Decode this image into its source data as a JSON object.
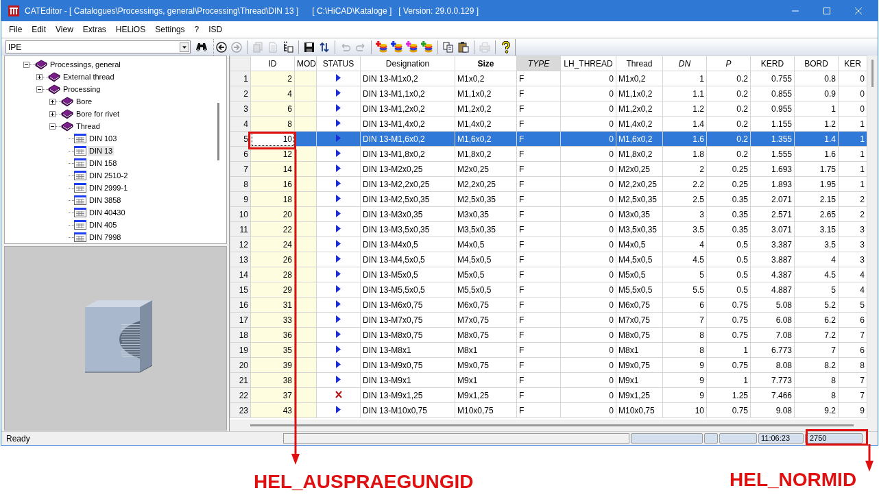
{
  "window": {
    "title": "CATEditor - [ Catalogues\\Processings, general\\Processing\\Thread\\DIN 13 ]      [ C:\\HiCAD\\Kataloge ]   [ Version: 29.0.0.129 ]"
  },
  "menu": [
    "File",
    "Edit",
    "View",
    "Extras",
    "HELiOS",
    "Settings",
    "?",
    "ISD"
  ],
  "combo": {
    "value": "IPE"
  },
  "toolbar": [
    {
      "kind": "back",
      "disabled": false
    },
    {
      "kind": "forward",
      "disabled": true
    },
    {
      "kind": "separator"
    },
    {
      "kind": "copy-doc",
      "disabled": true
    },
    {
      "kind": "doc",
      "disabled": true
    },
    {
      "kind": "doc-list",
      "disabled": false
    },
    {
      "kind": "separator"
    },
    {
      "kind": "save",
      "disabled": false
    },
    {
      "kind": "sort",
      "disabled": false
    },
    {
      "kind": "separator"
    },
    {
      "kind": "undo",
      "disabled": true
    },
    {
      "kind": "redo",
      "disabled": true
    },
    {
      "kind": "separator"
    },
    {
      "kind": "stack-add",
      "disabled": false,
      "color": "#e01010"
    },
    {
      "kind": "stack-add",
      "disabled": false,
      "color": "#1030e0"
    },
    {
      "kind": "stack-add",
      "disabled": false,
      "color": "#e020e0"
    },
    {
      "kind": "stack-add",
      "disabled": false,
      "color": "#20a020"
    },
    {
      "kind": "separator"
    },
    {
      "kind": "copy",
      "disabled": false
    },
    {
      "kind": "paste",
      "disabled": false
    },
    {
      "kind": "separator"
    },
    {
      "kind": "print",
      "disabled": true
    },
    {
      "kind": "separator"
    },
    {
      "kind": "help",
      "disabled": false
    }
  ],
  "tree": {
    "items": [
      {
        "label": "Processings, general",
        "kind": "folder",
        "expanded": true,
        "selected": false,
        "children": [
          {
            "label": "External thread",
            "kind": "folder",
            "expanded": false,
            "selected": false
          },
          {
            "label": "Processing",
            "kind": "folder",
            "expanded": true,
            "selected": false,
            "children": [
              {
                "label": "Bore",
                "kind": "folder",
                "expanded": false,
                "selected": false
              },
              {
                "label": "Bore for rivet",
                "kind": "folder",
                "expanded": false,
                "selected": false
              },
              {
                "label": "Thread",
                "kind": "folder",
                "expanded": true,
                "selected": false,
                "children": [
                  {
                    "label": "DIN 103",
                    "kind": "table",
                    "selected": false
                  },
                  {
                    "label": "DIN 13",
                    "kind": "table",
                    "selected": true
                  },
                  {
                    "label": "DIN 158",
                    "kind": "table",
                    "selected": false
                  },
                  {
                    "label": "DIN 2510-2",
                    "kind": "table",
                    "selected": false
                  },
                  {
                    "label": "DIN 2999-1",
                    "kind": "table",
                    "selected": false
                  },
                  {
                    "label": "DIN 3858",
                    "kind": "table",
                    "selected": false
                  },
                  {
                    "label": "DIN 40430",
                    "kind": "table",
                    "selected": false
                  },
                  {
                    "label": "DIN 405",
                    "kind": "table",
                    "selected": false
                  },
                  {
                    "label": "DIN 7998",
                    "kind": "table",
                    "selected": false
                  }
                ]
              }
            ]
          }
        ]
      }
    ]
  },
  "table": {
    "columns": [
      {
        "label": "ID",
        "selected": false
      },
      {
        "label": "MOD",
        "selected": false
      },
      {
        "label": "STATUS",
        "selected": false
      },
      {
        "label": "Designation",
        "selected": false
      },
      {
        "label": "Size",
        "selected": false
      },
      {
        "label": "TYPE",
        "selected": true
      },
      {
        "label": "LH_THREAD",
        "selected": false
      },
      {
        "label": "Thread",
        "selected": false
      },
      {
        "label": "DN",
        "selected": false
      },
      {
        "label": "P",
        "selected": false
      },
      {
        "label": "KERD",
        "selected": false
      },
      {
        "label": "BORD",
        "selected": false
      },
      {
        "label": "KER",
        "selected": false
      }
    ],
    "rows": [
      {
        "number": "1",
        "id": "2",
        "kind": "ok",
        "designation": "DIN 13-M1x0,2",
        "size": "M1x0,2",
        "type": "F",
        "lh_thread": "0",
        "thread": "M1x0,2",
        "dn": "1",
        "p": "0.2",
        "kerd": "0.755",
        "bord": "0.8",
        "column_13": "0",
        "selected": false
      },
      {
        "number": "2",
        "id": "4",
        "kind": "ok",
        "designation": "DIN 13-M1,1x0,2",
        "size": "M1,1x0,2",
        "type": "F",
        "lh_thread": "0",
        "thread": "M1,1x0,2",
        "dn": "1.1",
        "p": "0.2",
        "kerd": "0.855",
        "bord": "0.9",
        "column_13": "0",
        "selected": false
      },
      {
        "number": "3",
        "id": "6",
        "kind": "ok",
        "designation": "DIN 13-M1,2x0,2",
        "size": "M1,2x0,2",
        "type": "F",
        "lh_thread": "0",
        "thread": "M1,2x0,2",
        "dn": "1.2",
        "p": "0.2",
        "kerd": "0.955",
        "bord": "1",
        "column_13": "0",
        "selected": false
      },
      {
        "number": "4",
        "id": "8",
        "kind": "ok",
        "designation": "DIN 13-M1,4x0,2",
        "size": "M1,4x0,2",
        "type": "F",
        "lh_thread": "0",
        "thread": "M1,4x0,2",
        "dn": "1.4",
        "p": "0.2",
        "kerd": "1.155",
        "bord": "1.2",
        "column_13": "1",
        "selected": false
      },
      {
        "number": "5",
        "id": "10",
        "kind": "ok",
        "designation": "DIN 13-M1,6x0,2",
        "size": "M1,6x0,2",
        "type": "F",
        "lh_thread": "0",
        "thread": "M1,6x0,2",
        "dn": "1.6",
        "p": "0.2",
        "kerd": "1.355",
        "bord": "1.4",
        "column_13": "1",
        "selected": true
      },
      {
        "number": "6",
        "id": "12",
        "kind": "ok",
        "designation": "DIN 13-M1,8x0,2",
        "size": "M1,8x0,2",
        "type": "F",
        "lh_thread": "0",
        "thread": "M1,8x0,2",
        "dn": "1.8",
        "p": "0.2",
        "kerd": "1.555",
        "bord": "1.6",
        "column_13": "1",
        "selected": false
      },
      {
        "number": "7",
        "id": "14",
        "kind": "ok",
        "designation": "DIN 13-M2x0,25",
        "size": "M2x0,25",
        "type": "F",
        "lh_thread": "0",
        "thread": "M2x0,25",
        "dn": "2",
        "p": "0.25",
        "kerd": "1.693",
        "bord": "1.75",
        "column_13": "1",
        "selected": false
      },
      {
        "number": "8",
        "id": "16",
        "kind": "ok",
        "designation": "DIN 13-M2,2x0,25",
        "size": "M2,2x0,25",
        "type": "F",
        "lh_thread": "0",
        "thread": "M2,2x0,25",
        "dn": "2.2",
        "p": "0.25",
        "kerd": "1.893",
        "bord": "1.95",
        "column_13": "1",
        "selected": false
      },
      {
        "number": "9",
        "id": "18",
        "kind": "ok",
        "designation": "DIN 13-M2,5x0,35",
        "size": "M2,5x0,35",
        "type": "F",
        "lh_thread": "0",
        "thread": "M2,5x0,35",
        "dn": "2.5",
        "p": "0.35",
        "kerd": "2.071",
        "bord": "2.15",
        "column_13": "2",
        "selected": false
      },
      {
        "number": "10",
        "id": "20",
        "kind": "ok",
        "designation": "DIN 13-M3x0,35",
        "size": "M3x0,35",
        "type": "F",
        "lh_thread": "0",
        "thread": "M3x0,35",
        "dn": "3",
        "p": "0.35",
        "kerd": "2.571",
        "bord": "2.65",
        "column_13": "2",
        "selected": false
      },
      {
        "number": "11",
        "id": "22",
        "kind": "ok",
        "designation": "DIN 13-M3,5x0,35",
        "size": "M3,5x0,35",
        "type": "F",
        "lh_thread": "0",
        "thread": "M3,5x0,35",
        "dn": "3.5",
        "p": "0.35",
        "kerd": "3.071",
        "bord": "3.15",
        "column_13": "3",
        "selected": false
      },
      {
        "number": "12",
        "id": "24",
        "kind": "ok",
        "designation": "DIN 13-M4x0,5",
        "size": "M4x0,5",
        "type": "F",
        "lh_thread": "0",
        "thread": "M4x0,5",
        "dn": "4",
        "p": "0.5",
        "kerd": "3.387",
        "bord": "3.5",
        "column_13": "3",
        "selected": false
      },
      {
        "number": "13",
        "id": "26",
        "kind": "ok",
        "designation": "DIN 13-M4,5x0,5",
        "size": "M4,5x0,5",
        "type": "F",
        "lh_thread": "0",
        "thread": "M4,5x0,5",
        "dn": "4.5",
        "p": "0.5",
        "kerd": "3.887",
        "bord": "4",
        "column_13": "3",
        "selected": false
      },
      {
        "number": "14",
        "id": "28",
        "kind": "ok",
        "designation": "DIN 13-M5x0,5",
        "size": "M5x0,5",
        "type": "F",
        "lh_thread": "0",
        "thread": "M5x0,5",
        "dn": "5",
        "p": "0.5",
        "kerd": "4.387",
        "bord": "4.5",
        "column_13": "4",
        "selected": false
      },
      {
        "number": "15",
        "id": "29",
        "kind": "ok",
        "designation": "DIN 13-M5,5x0,5",
        "size": "M5,5x0,5",
        "type": "F",
        "lh_thread": "0",
        "thread": "M5,5x0,5",
        "dn": "5.5",
        "p": "0.5",
        "kerd": "4.887",
        "bord": "5",
        "column_13": "4",
        "selected": false
      },
      {
        "number": "16",
        "id": "31",
        "kind": "ok",
        "designation": "DIN 13-M6x0,75",
        "size": "M6x0,75",
        "type": "F",
        "lh_thread": "0",
        "thread": "M6x0,75",
        "dn": "6",
        "p": "0.75",
        "kerd": "5.08",
        "bord": "5.2",
        "column_13": "5",
        "selected": false
      },
      {
        "number": "17",
        "id": "33",
        "kind": "ok",
        "designation": "DIN 13-M7x0,75",
        "size": "M7x0,75",
        "type": "F",
        "lh_thread": "0",
        "thread": "M7x0,75",
        "dn": "7",
        "p": "0.75",
        "kerd": "6.08",
        "bord": "6.2",
        "column_13": "6",
        "selected": false
      },
      {
        "number": "18",
        "id": "36",
        "kind": "ok",
        "designation": "DIN 13-M8x0,75",
        "size": "M8x0,75",
        "type": "F",
        "lh_thread": "0",
        "thread": "M8x0,75",
        "dn": "8",
        "p": "0.75",
        "kerd": "7.08",
        "bord": "7.2",
        "column_13": "7",
        "selected": false
      },
      {
        "number": "19",
        "id": "35",
        "kind": "ok",
        "designation": "DIN 13-M8x1",
        "size": "M8x1",
        "type": "F",
        "lh_thread": "0",
        "thread": "M8x1",
        "dn": "8",
        "p": "1",
        "kerd": "6.773",
        "bord": "7",
        "column_13": "6",
        "selected": false
      },
      {
        "number": "20",
        "id": "39",
        "kind": "ok",
        "designation": "DIN 13-M9x0,75",
        "size": "M9x0,75",
        "type": "F",
        "lh_thread": "0",
        "thread": "M9x0,75",
        "dn": "9",
        "p": "0.75",
        "kerd": "8.08",
        "bord": "8.2",
        "column_13": "8",
        "selected": false
      },
      {
        "number": "21",
        "id": "38",
        "kind": "ok",
        "designation": "DIN 13-M9x1",
        "size": "M9x1",
        "type": "F",
        "lh_thread": "0",
        "thread": "M9x1",
        "dn": "9",
        "p": "1",
        "kerd": "7.773",
        "bord": "8",
        "column_13": "7",
        "selected": false
      },
      {
        "number": "22",
        "id": "37",
        "kind": "error",
        "designation": "DIN 13-M9x1,25",
        "size": "M9x1,25",
        "type": "F",
        "lh_thread": "0",
        "thread": "M9x1,25",
        "dn": "9",
        "p": "1.25",
        "kerd": "7.466",
        "bord": "8",
        "column_13": "7",
        "selected": false
      },
      {
        "number": "23",
        "id": "43",
        "kind": "ok",
        "designation": "DIN 13-M10x0,75",
        "size": "M10x0,75",
        "type": "F",
        "lh_thread": "0",
        "thread": "M10x0,75",
        "dn": "10",
        "p": "0.75",
        "kerd": "9.08",
        "bord": "9.2",
        "column_13": "9",
        "selected": false
      }
    ]
  },
  "status_bar": {
    "message": "Ready",
    "time": "11:06:23",
    "norm_id": "2750"
  },
  "annotations": [
    {
      "label": "HEL_AUSPRAEGUNGID"
    },
    {
      "label": "HEL_NORMID"
    }
  ]
}
